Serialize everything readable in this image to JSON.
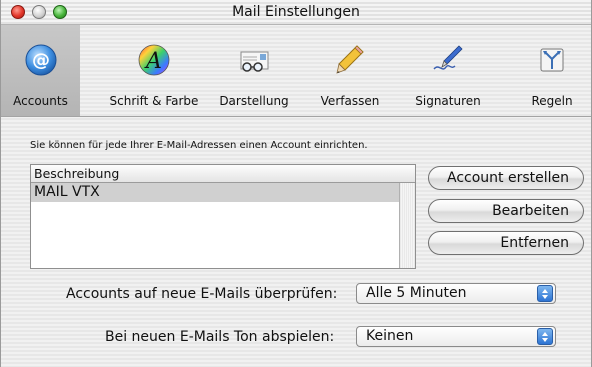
{
  "window": {
    "title": "Mail Einstellungen"
  },
  "toolbar": {
    "items": [
      {
        "label": "Accounts",
        "icon": "at-sign-icon",
        "selected": true
      },
      {
        "label": "Schrift & Farbe",
        "icon": "font-color-icon",
        "selected": false
      },
      {
        "label": "Darstellung",
        "icon": "glasses-envelope-icon",
        "selected": false
      },
      {
        "label": "Verfassen",
        "icon": "pencil-icon",
        "selected": false
      },
      {
        "label": "Signaturen",
        "icon": "fountain-pen-icon",
        "selected": false
      },
      {
        "label": "Regeln",
        "icon": "rules-icon",
        "selected": false
      }
    ]
  },
  "accounts": {
    "hint": "Sie können für jede Ihrer E-Mail-Adressen einen Account einrichten.",
    "list_header": "Beschreibung",
    "rows": [
      "MAIL VTX"
    ],
    "buttons": {
      "create": "Account erstellen",
      "edit": "Bearbeiten",
      "remove": "Entfernen"
    }
  },
  "options": {
    "check_label": "Accounts auf neue E-Mails überprüfen:",
    "check_value": "Alle 5 Minuten",
    "sound_label": "Bei neuen E-Mails Ton abspielen:",
    "sound_value": "Keinen"
  },
  "colors": {
    "selection_gray": "#d0d0d0",
    "popup_blue": "#2d74d3",
    "close_red": "#e2362a",
    "zoom_green": "#47b43a"
  }
}
